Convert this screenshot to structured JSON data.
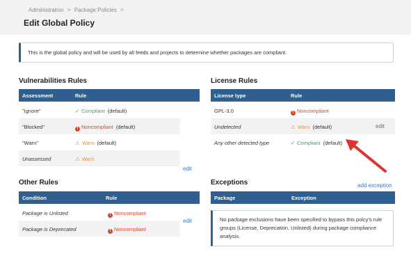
{
  "breadcrumb": [
    "Administration",
    ">",
    "Package Policies",
    ">"
  ],
  "page_title": "Edit Global Policy",
  "info_text": "This is the global policy and will be used by all feeds and projects to determine whether packages are compliant.",
  "vuln": {
    "title": "Vulnerabilities Rules",
    "col1": "Assessment",
    "col2": "Rule",
    "rows": [
      {
        "assessment": "\"Ignore\"",
        "rule": "Compliant",
        "default": "(default)"
      },
      {
        "assessment": "\"Blocked\"",
        "rule": "Noncompliant",
        "default": "(default)"
      },
      {
        "assessment": "\"Warn\"",
        "rule": "Warn",
        "default": "(default)"
      },
      {
        "assessment": "Unassessed",
        "rule": "Warn",
        "default": ""
      }
    ],
    "edit": "edit"
  },
  "license": {
    "title": "License Rules",
    "col1": "License type",
    "col2": "Rule",
    "rows": [
      {
        "type": "GPL-3.0",
        "rule": "Noncompliant",
        "default": ""
      },
      {
        "type": "Undetected",
        "rule": "Warn",
        "default": "(default)"
      },
      {
        "type": "Any other detected type",
        "rule": "Compliant",
        "default": "(default)"
      }
    ],
    "edit": "edit"
  },
  "other": {
    "title": "Other Rules",
    "col1": "Condition",
    "col2": "Rule",
    "rows": [
      {
        "condition": "Package is Unlisted",
        "rule": "Noncompliant"
      },
      {
        "condition": "Package is Deprecated",
        "rule": "Noncompliant"
      }
    ],
    "edit": "edit"
  },
  "exceptions": {
    "title": "Exceptions",
    "add": "add exception",
    "col1": "Package",
    "col2": "Exception",
    "empty_text": "No package exclusions have been specified to bypass this polcy's rule groups (License, Deprecation, Unlisted) during package compliance analysis."
  },
  "colors": {
    "header": "#2f5f8f",
    "green": "#3f9e6e",
    "red": "#d2472c",
    "orange": "#e7913d",
    "arrow": "#e0322f"
  }
}
